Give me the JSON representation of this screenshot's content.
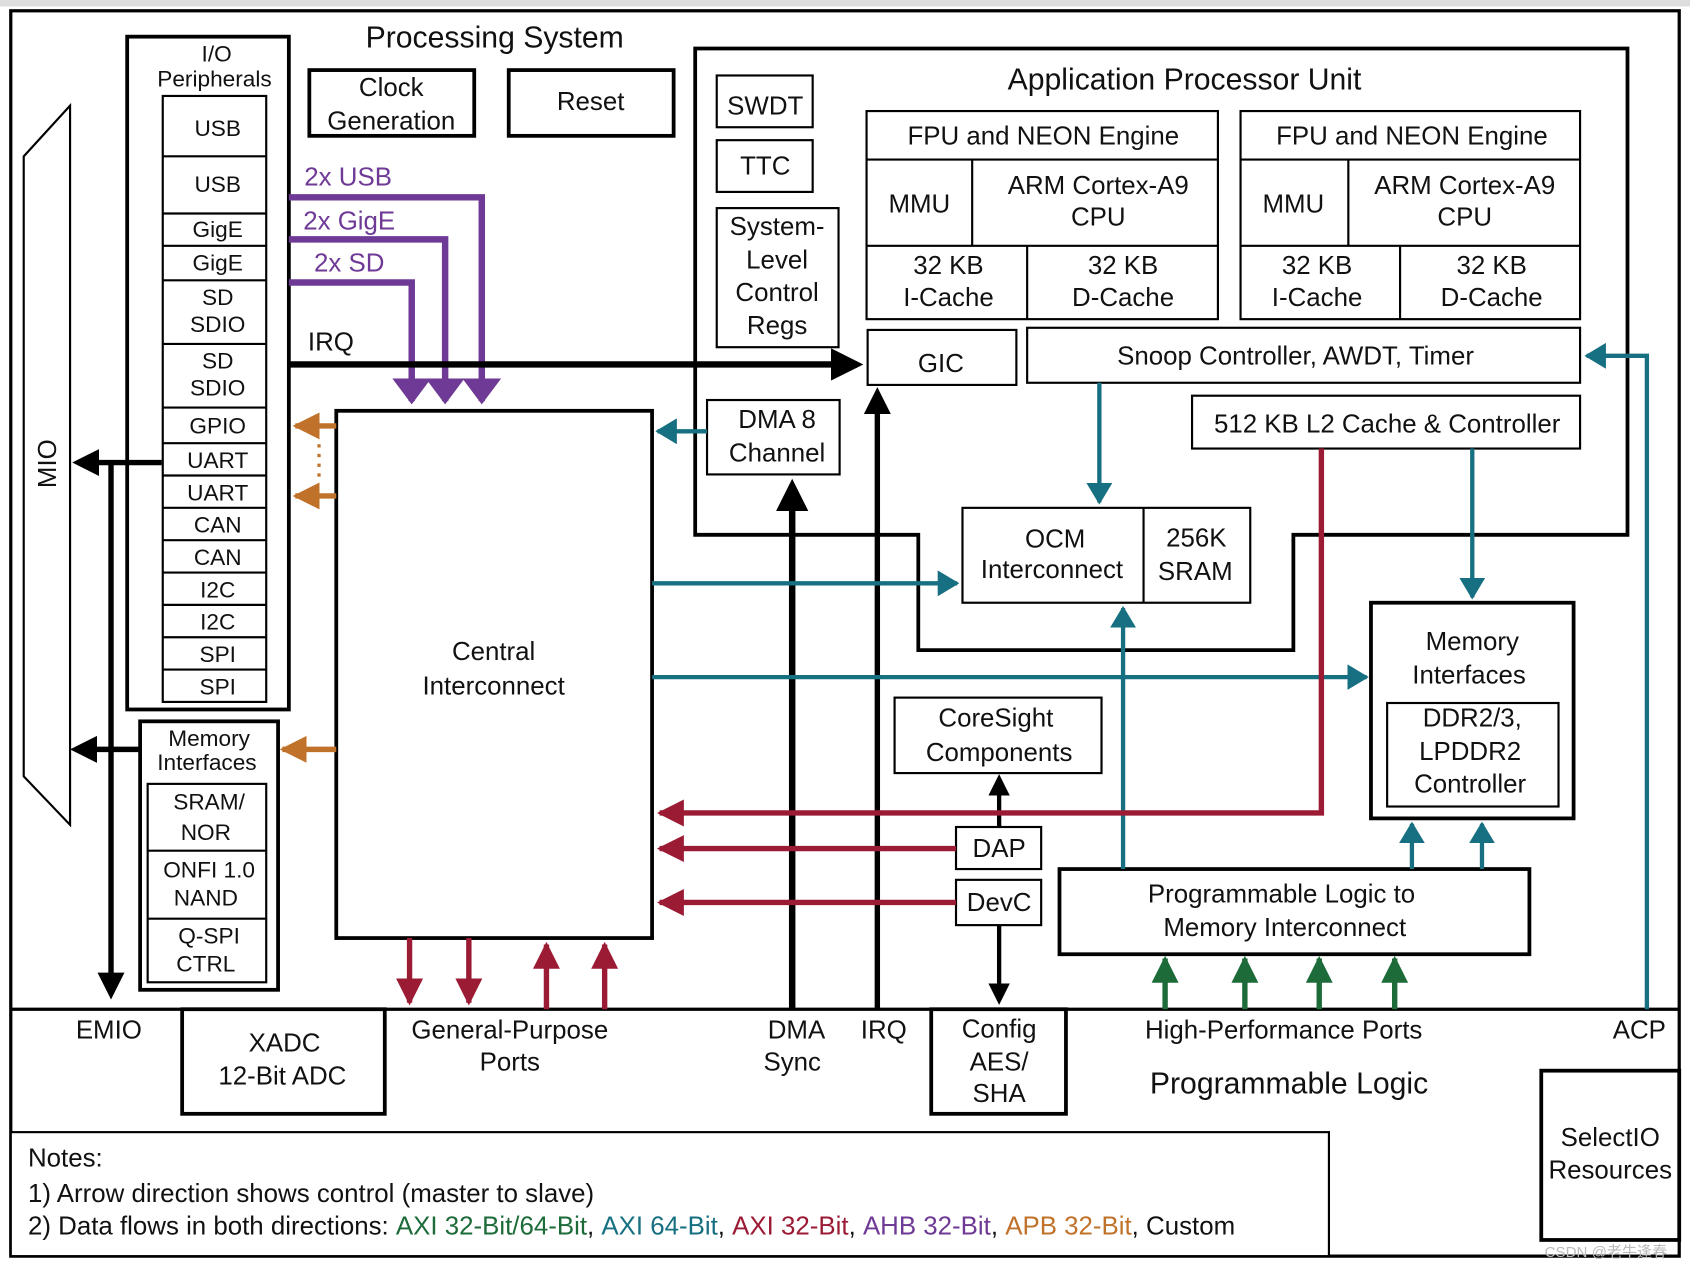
{
  "title": "Processing System",
  "mio": "MIO",
  "io": {
    "title": [
      "I/O",
      "Peripherals"
    ],
    "cells": [
      "USB",
      "USB",
      "GigE",
      "GigE",
      [
        "SD",
        "SDIO"
      ],
      [
        "SD",
        "SDIO"
      ],
      "GPIO",
      "UART",
      "UART",
      "CAN",
      "CAN",
      "I2C",
      "I2C",
      "SPI",
      "SPI"
    ]
  },
  "clock": [
    "Clock",
    "Generation"
  ],
  "reset": "Reset",
  "bus_labels": {
    "usb": "2x USB",
    "gige": "2x GigE",
    "sd": "2x SD",
    "irq": "IRQ"
  },
  "apu": {
    "title": "Application Processor Unit",
    "swdt": "SWDT",
    "ttc": "TTC",
    "slcr": [
      "System-",
      "Level",
      "Control",
      "Regs"
    ],
    "cores": [
      {
        "fpu": "FPU and NEON Engine",
        "mmu": "MMU",
        "cpu": [
          "ARM Cortex-A9",
          "CPU"
        ],
        "icache": [
          "32 KB",
          "I-Cache"
        ],
        "dcache": [
          "32 KB",
          "D-Cache"
        ]
      },
      {
        "fpu": "FPU and NEON Engine",
        "mmu": "MMU",
        "cpu": [
          "ARM Cortex-A9",
          "CPU"
        ],
        "icache": [
          "32 KB",
          "I-Cache"
        ],
        "dcache": [
          "32 KB",
          "D-Cache"
        ]
      }
    ],
    "gic": "GIC",
    "snoop": "Snoop Controller, AWDT, Timer",
    "l2": "512 KB L2 Cache & Controller"
  },
  "dma": [
    "DMA 8",
    "Channel"
  ],
  "ocm": {
    "interconnect": [
      "OCM",
      "Interconnect"
    ],
    "sram": [
      "256K",
      "SRAM"
    ]
  },
  "central": [
    "Central",
    "Interconnect"
  ],
  "mem_right": {
    "title": [
      "Memory",
      "Interfaces"
    ],
    "ctrl": [
      "DDR2/3,",
      "LPDDR2",
      "Controller"
    ]
  },
  "mem_left": {
    "title": [
      "Memory",
      "Interfaces"
    ],
    "items": [
      [
        "SRAM/",
        "NOR"
      ],
      [
        "ONFI 1.0",
        "NAND"
      ],
      [
        "Q-SPI",
        "CTRL"
      ]
    ]
  },
  "coresight": [
    "CoreSight",
    "Components"
  ],
  "dap": "DAP",
  "devc": "DevC",
  "pl_mem": [
    "Programmable Logic to",
    "Memory Interconnect"
  ],
  "pl": {
    "emio": "EMIO",
    "xadc": [
      "XADC",
      "12-Bit ADC"
    ],
    "gp_ports": [
      "General-Purpose",
      "Ports"
    ],
    "dma_sync": [
      "DMA",
      "Sync"
    ],
    "irq": "IRQ",
    "config": [
      "Config",
      "AES/",
      "SHA"
    ],
    "hp_ports": "High-Performance Ports",
    "acp": "ACP",
    "title": "Programmable Logic",
    "selectio": [
      "SelectIO",
      "Resources"
    ]
  },
  "notes": {
    "title": "Notes:",
    "line1": "1) Arrow direction shows control (master to slave)",
    "line2_prefix": "2) Data flows in both directions: ",
    "legend": [
      {
        "text": "AXI 32-Bit/64-Bit",
        "color": "#1e6b3a"
      },
      {
        "text": "AXI 64-Bit",
        "color": "#176f82"
      },
      {
        "text": "AXI 32-Bit",
        "color": "#9b1b34"
      },
      {
        "text": "AHB 32-Bit",
        "color": "#6f3a96"
      },
      {
        "text": "APB 32-Bit",
        "color": "#c0712a"
      },
      {
        "text": "Custom",
        "color": "#111111"
      }
    ]
  },
  "watermark": "CSDN @老牛逢春"
}
